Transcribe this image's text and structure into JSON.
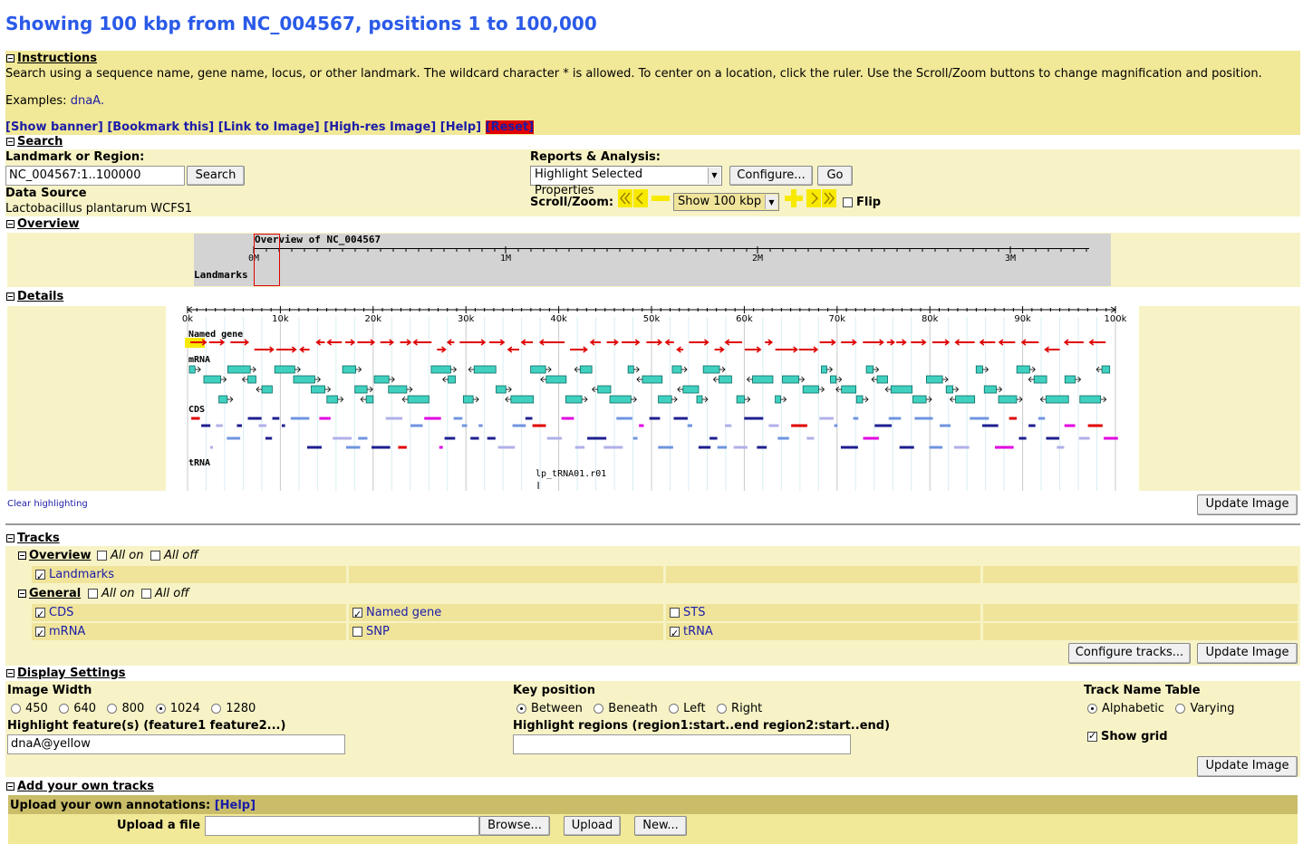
{
  "page_title": "Showing 100 kbp from NC_004567, positions 1 to 100,000",
  "instructions": {
    "heading": "Instructions",
    "text": "Search using a sequence name, gene name, locus, or other landmark. The wildcard character * is allowed. To center on a location, click the ruler. Use the Scroll/Zoom buttons to change magnification and position.",
    "examples_label": "Examples:",
    "examples_link": "dnaA.",
    "links": [
      "[Show banner]",
      "[Bookmark this]",
      "[Link to Image]",
      "[High-res Image]",
      "[Help]"
    ],
    "reset_label": "[Reset]"
  },
  "search": {
    "heading": "Search",
    "landmark_label": "Landmark or Region:",
    "landmark_value": "NC_004567:1..100000",
    "search_button": "Search",
    "data_source_label": "Data Source",
    "data_source_value": "Lactobacillus plantarum WCFS1",
    "reports_label": "Reports & Analysis:",
    "reports_selected": "Highlight Selected Properties",
    "configure_button": "Configure...",
    "go_button": "Go",
    "scroll_zoom_label": "Scroll/Zoom:",
    "zoom_selected": "Show 100 kbp",
    "flip_label": "Flip"
  },
  "overview": {
    "heading": "Overview",
    "panel_title": "Overview of NC_004567",
    "ticks": [
      "0M",
      "1M",
      "2M",
      "3M"
    ],
    "track_label": "Landmarks"
  },
  "details": {
    "heading": "Details",
    "ruler_ticks": [
      "0k",
      "10k",
      "20k",
      "30k",
      "40k",
      "50k",
      "60k",
      "70k",
      "80k",
      "90k",
      "100k"
    ],
    "tracks": [
      "Named gene",
      "mRNA",
      "CDS",
      "tRNA"
    ],
    "trna_label": "lp_tRNA01.r01",
    "clear_highlighting": "Clear highlighting",
    "update_button": "Update Image"
  },
  "tracks_section": {
    "heading": "Tracks",
    "overview_group": "Overview",
    "general_group": "General",
    "all_on": "All on",
    "all_off": "All off",
    "overview_tracks": [
      {
        "label": "Landmarks",
        "checked": true
      }
    ],
    "general_tracks": [
      {
        "label": "CDS",
        "checked": true
      },
      {
        "label": "Named gene",
        "checked": true
      },
      {
        "label": "STS",
        "checked": false
      },
      {
        "label": "mRNA",
        "checked": true
      },
      {
        "label": "SNP",
        "checked": false
      },
      {
        "label": "tRNA",
        "checked": true
      }
    ],
    "configure_tracks_button": "Configure tracks...",
    "update_button": "Update Image"
  },
  "display_settings": {
    "heading": "Display Settings",
    "image_width_label": "Image Width",
    "widths": [
      "450",
      "640",
      "800",
      "1024",
      "1280"
    ],
    "selected_width": "1024",
    "key_position_label": "Key position",
    "key_positions": [
      "Between",
      "Beneath",
      "Left",
      "Right"
    ],
    "selected_key_position": "Between",
    "track_name_table_label": "Track Name Table",
    "track_name_options": [
      "Alphabetic",
      "Varying"
    ],
    "selected_track_name": "Alphabetic",
    "highlight_features_label": "Highlight feature(s) (feature1 feature2...)",
    "highlight_features_value": "dnaA@yellow",
    "highlight_regions_label": "Highlight regions (region1:start..end region2:start..end)",
    "highlight_regions_value": "",
    "show_grid_label": "Show grid",
    "update_button": "Update Image"
  },
  "add_tracks": {
    "heading": "Add your own tracks",
    "upload_heading": "Upload your own annotations:",
    "help_link": "[Help]",
    "upload_file_label": "Upload a file",
    "browse_button": "Browse...",
    "upload_button": "Upload",
    "new_button": "New..."
  },
  "colors": {
    "title_blue": "#2a5ae8",
    "panel_yellow": "#f1e898",
    "light_yellow": "#f7f3c6",
    "gene_red": "#e00000",
    "mrna_teal": "#40d0c0",
    "cds_blue": "#1e1e90",
    "cds_lightblue": "#6f94e0",
    "reset_red": "#e00000"
  }
}
